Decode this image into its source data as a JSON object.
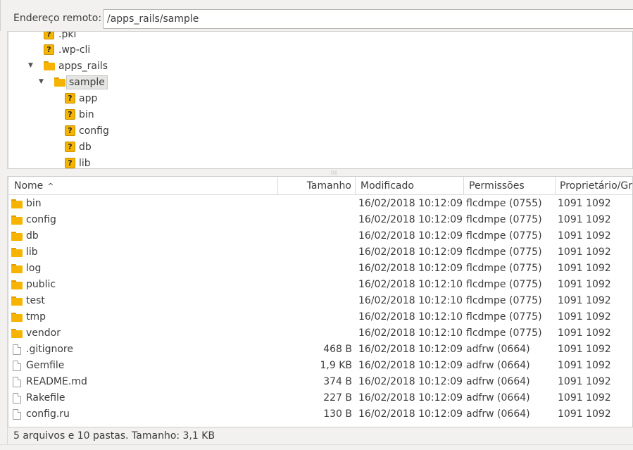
{
  "address_bar": {
    "label": "Endereço remoto:",
    "value": "/apps_rails/sample"
  },
  "tree": {
    "items": [
      {
        "label": ".pki",
        "icon": "unknown-icon"
      },
      {
        "label": ".wp-cli",
        "icon": "unknown-icon"
      },
      {
        "label": "apps_rails",
        "icon": "folder-icon",
        "expanded": true
      },
      {
        "label": "sample",
        "icon": "folder-icon",
        "expanded": true,
        "selected": true
      },
      {
        "label": "app",
        "icon": "unknown-icon"
      },
      {
        "label": "bin",
        "icon": "unknown-icon"
      },
      {
        "label": "config",
        "icon": "unknown-icon"
      },
      {
        "label": "db",
        "icon": "unknown-icon"
      },
      {
        "label": "lib",
        "icon": "unknown-icon"
      }
    ]
  },
  "list": {
    "columns": [
      "Nome",
      "Tamanho",
      "Modificado",
      "Permissões",
      "Proprietário/Gr"
    ],
    "sort_indicator": "^",
    "rows": [
      {
        "name": "bin",
        "type": "folder",
        "size": "",
        "modified": "16/02/2018 10:12:09",
        "perms": "flcdmpe (0755)",
        "owner": "1091 1092"
      },
      {
        "name": "config",
        "type": "folder",
        "size": "",
        "modified": "16/02/2018 10:12:09",
        "perms": "flcdmpe (0775)",
        "owner": "1091 1092"
      },
      {
        "name": "db",
        "type": "folder",
        "size": "",
        "modified": "16/02/2018 10:12:09",
        "perms": "flcdmpe (0775)",
        "owner": "1091 1092"
      },
      {
        "name": "lib",
        "type": "folder",
        "size": "",
        "modified": "16/02/2018 10:12:09",
        "perms": "flcdmpe (0775)",
        "owner": "1091 1092"
      },
      {
        "name": "log",
        "type": "folder",
        "size": "",
        "modified": "16/02/2018 10:12:09",
        "perms": "flcdmpe (0775)",
        "owner": "1091 1092"
      },
      {
        "name": "public",
        "type": "folder",
        "size": "",
        "modified": "16/02/2018 10:12:10",
        "perms": "flcdmpe (0775)",
        "owner": "1091 1092"
      },
      {
        "name": "test",
        "type": "folder",
        "size": "",
        "modified": "16/02/2018 10:12:10",
        "perms": "flcdmpe (0775)",
        "owner": "1091 1092"
      },
      {
        "name": "tmp",
        "type": "folder",
        "size": "",
        "modified": "16/02/2018 10:12:10",
        "perms": "flcdmpe (0775)",
        "owner": "1091 1092"
      },
      {
        "name": "vendor",
        "type": "folder",
        "size": "",
        "modified": "16/02/2018 10:12:10",
        "perms": "flcdmpe (0775)",
        "owner": "1091 1092"
      },
      {
        "name": ".gitignore",
        "type": "file",
        "size": "468 B",
        "modified": "16/02/2018 10:12:09",
        "perms": "adfrw (0664)",
        "owner": "1091 1092"
      },
      {
        "name": "Gemfile",
        "type": "file",
        "size": "1,9 KB",
        "modified": "16/02/2018 10:12:09",
        "perms": "adfrw (0664)",
        "owner": "1091 1092"
      },
      {
        "name": "README.md",
        "type": "file",
        "size": "374 B",
        "modified": "16/02/2018 10:12:09",
        "perms": "adfrw (0664)",
        "owner": "1091 1092"
      },
      {
        "name": "Rakefile",
        "type": "file",
        "size": "227 B",
        "modified": "16/02/2018 10:12:09",
        "perms": "adfrw (0664)",
        "owner": "1091 1092"
      },
      {
        "name": "config.ru",
        "type": "file",
        "size": "130 B",
        "modified": "16/02/2018 10:12:09",
        "perms": "adfrw (0664)",
        "owner": "1091 1092"
      }
    ]
  },
  "status": {
    "text": "5 arquivos e 10 pastas. Tamanho: 3,1 KB"
  }
}
